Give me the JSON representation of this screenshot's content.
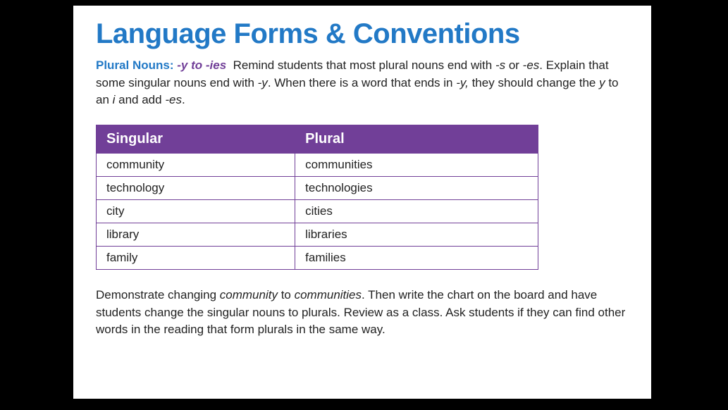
{
  "title": "Language Forms & Conventions",
  "lead": {
    "label": "Plural Nouns:",
    "sub": "-y to -ies",
    "text_a": "Remind students that most plural nouns end with ",
    "em1": "-s",
    "text_b": " or ",
    "em2": "-es",
    "text_c": ". Explain that some singular nouns end with ",
    "em3": "-y",
    "text_d": ". When there is a word that ends in ",
    "em4": "-y,",
    "text_e": " they should change the ",
    "em5": "y",
    "text_f": " to an ",
    "em6": "i",
    "text_g": " and add ",
    "em7": "-es",
    "text_h": "."
  },
  "table": {
    "header": {
      "singular": "Singular",
      "plural": "Plural"
    },
    "rows": [
      {
        "singular": "community",
        "plural": "communities"
      },
      {
        "singular": "technology",
        "plural": "technologies"
      },
      {
        "singular": "city",
        "plural": "cities"
      },
      {
        "singular": "library",
        "plural": "libraries"
      },
      {
        "singular": "family",
        "plural": "families"
      }
    ]
  },
  "footer": {
    "t1": "Demonstrate changing ",
    "e1": "community",
    "t2": " to ",
    "e2": "communities",
    "t3": ". Then write the chart on the board and have students change the singular nouns to plurals. Review as a class. Ask students if they can find other words in the reading that form plurals in the same way."
  }
}
